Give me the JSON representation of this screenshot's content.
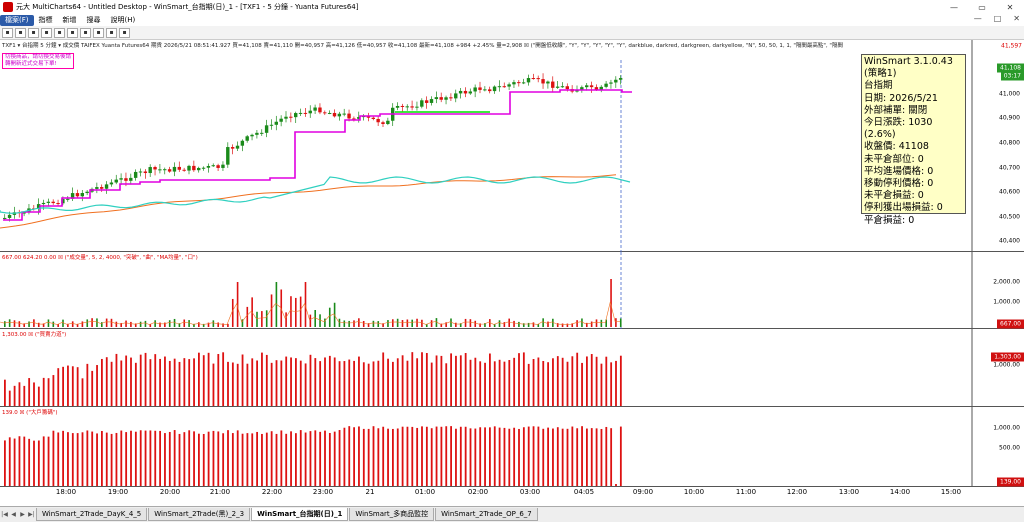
{
  "window": {
    "title": "元大 MultiCharts64 - Untitled Desktop - WinSmart_台指期(日)_1 - [TXF1 - 5 分鐘 - Yuanta Futures64]",
    "min": "—",
    "max": "▭",
    "close": "✕"
  },
  "menu": [
    "檔案(F)",
    "指標",
    "新增",
    "搜尋",
    "說明(H)"
  ],
  "menu_right": [
    "—",
    "□",
    "✕"
  ],
  "price_info": "TXF1 ▾ 台指期 5 分鐘 ▾ 成交價 TAIFEX Yuanta Futures64 期貨 2026/5/21 08:51:41.927 買=41,108 賣=41,110 開=40,957 高=41,126 低=40,957 收=41,108 最新=41,108 +984 +2.45% 量=2,908 ☒ (\"開盤低收線\", \"Y\", \"Y\", \"Y\", \"Y\", \"Y\", darkblue, darkred, darkgreen, darkyellow, \"N\", 50, 50, 1, 1, \"隔間最高點\", \"隔間",
  "warning": [
    "切換商品，請切換交易後請",
    "轉開新近式交易下單!"
  ],
  "strategy_box": [
    "WinSmart 3.1.0.43",
    "(策略1)",
    "台指期",
    "日期: 2026/5/21",
    "外部補單: 關閉",
    "今日漲跌: 1030 (2.6%)",
    "收盤價: 41108",
    "未平倉部位: 0",
    "平均進場價格: 0",
    "移動停利價格: 0",
    "未平倉損益: 0",
    "停利獲出場損益: 0",
    "平倉損益: 0"
  ],
  "price_axis": {
    "labels": [
      "41,000",
      "40,900",
      "40,800",
      "40,700",
      "40,600",
      "40,500",
      "40,400"
    ],
    "top_value": "41,597",
    "last_tag": "41,108",
    "time_tag": "03:17"
  },
  "volume_pane": {
    "label": "667.00 624.20 0.00 ☒ (\"成交量\", 5, 2, 4000, \"突破\", \"曲\", \"MA均量\", \"口\")",
    "axis": [
      "2,000.00",
      "1,000.00"
    ],
    "tag": "667.00"
  },
  "pane3": {
    "label": "1,303.00 ☒ (\"買賣力道\")",
    "axis": [
      "1,000.00"
    ],
    "tag": "1,303.00"
  },
  "pane4": {
    "label": "139.0 ☒ (\"大戶籌碼\")",
    "axis": [
      "1,000.00",
      "500.00"
    ],
    "tag": "139.00"
  },
  "time_axis": [
    "18:00",
    "19:00",
    "20:00",
    "21:00",
    "22:00",
    "23:00",
    "21",
    "01:00",
    "02:00",
    "03:00",
    "04:05",
    "09:00",
    "10:00",
    "11:00",
    "12:00",
    "13:00",
    "14:00",
    "15:00"
  ],
  "tabs": [
    "WinSmart_2Trade_DayK_4_5",
    "WinSmart_2Trade(黑)_2_3",
    "WinSmart_台指期(日)_1",
    "WinSmart_多商品監控",
    "WinSmart_2Trade_OP_6_7"
  ],
  "active_tab": 2,
  "colors": {
    "up": "#1a8a1a",
    "down": "#dd1111",
    "magenta": "#e000e0",
    "orange": "#f07020",
    "cyan": "#30d0c0",
    "green": "#00dd00"
  }
}
